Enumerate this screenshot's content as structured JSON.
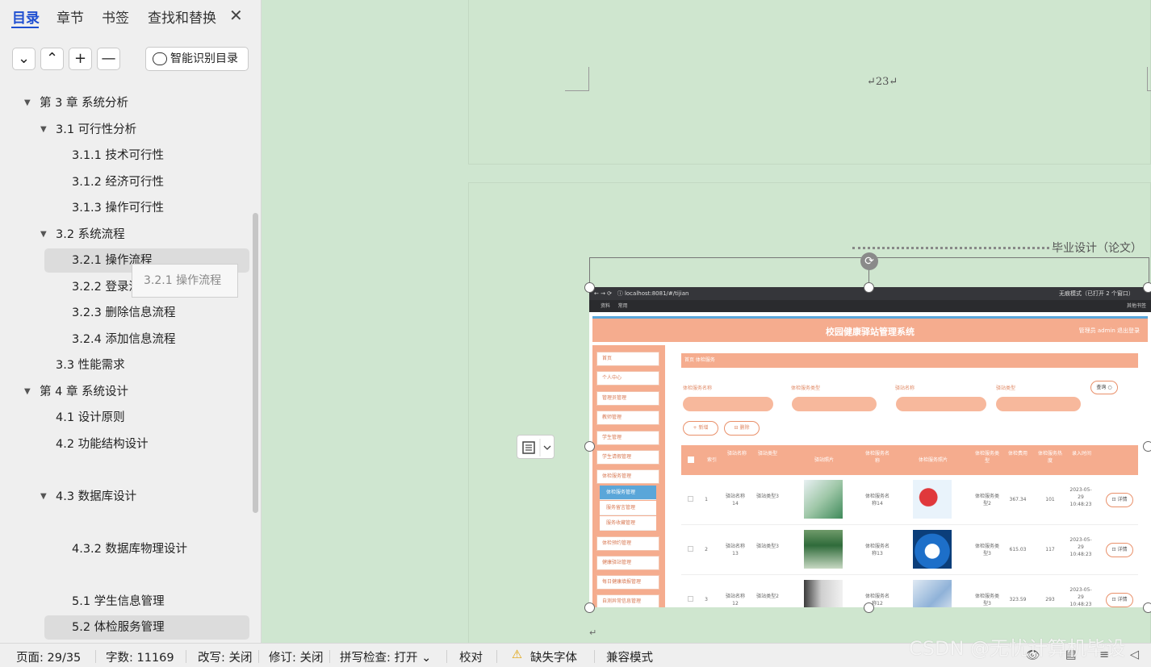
{
  "sidebar": {
    "tabs": [
      "目录",
      "章节",
      "书签",
      "查找和替换"
    ],
    "close": "✕",
    "toolbar": {
      "collapse": "⌄",
      "expand": "⌃",
      "add": "+",
      "remove": "—",
      "smart": "智能识别目录"
    },
    "items": [
      {
        "label": "第 3 章  系统分析",
        "expanded": true
      },
      {
        "label": "3.1  可行性分析",
        "expanded": true
      },
      {
        "label": "3.1.1  技术可行性"
      },
      {
        "label": "3.1.2  经济可行性"
      },
      {
        "label": "3.1.3  操作可行性"
      },
      {
        "label": "3.2  系统流程",
        "expanded": true
      },
      {
        "label": "3.2.1  操作流程",
        "hover": true
      },
      {
        "label": "3.2.2  登录流程"
      },
      {
        "label": "3.2.3  删除信息流程"
      },
      {
        "label": "3.2.4  添加信息流程"
      },
      {
        "label": "3.3  性能需求"
      },
      {
        "label": "第 4 章  系统设计",
        "expanded": true
      },
      {
        "label": "4.1  设计原则"
      },
      {
        "label": "4.2  功能结构设计"
      },
      {
        "label": "4.3  数据库设计",
        "expanded": true
      },
      {
        "label": "4.3.2  数据库物理设计"
      },
      {
        "label": "5.1 学生信息管理"
      },
      {
        "label": "5.2  体检服务管理",
        "selected": true
      }
    ],
    "tooltip": "3.2.1 操作流程"
  },
  "document": {
    "page_number": "↵23↵",
    "header_text": "毕业设计（论文）",
    "paragraph_mark": "↵"
  },
  "screenshot": {
    "url": "localhost:8081/#/tijian",
    "incognito": "无痕模式（已打开 2 个窗口）",
    "bookmarks": [
      "资料",
      "常用"
    ],
    "other_bookmarks": "其他书签",
    "app_title": "校园健康驿站管理系统",
    "app_user": "管理员 admin    退出登录",
    "menu": [
      "首页",
      "个人中心",
      "管理员管理",
      "教师管理",
      "学生管理",
      "学生请假管理",
      "体检服务管理"
    ],
    "submenu": [
      "体检服务管理",
      "服务留言管理",
      "服务收藏管理"
    ],
    "menu_after": [
      "体检预约管理",
      "健康驿站管理",
      "每日健康填报管理",
      "自测异常信息管理"
    ],
    "breadcrumb": "首页    体检服务",
    "filters": [
      "体检服务名称",
      "体检服务类型",
      "驿站名称",
      "驿站类型"
    ],
    "filter_placeholders": [
      "体检服务名称",
      "请选择体检服务类型",
      "驿站名称",
      "请选择驿站类型"
    ],
    "query": "查询 ○",
    "add": "+ 新增",
    "delete": "⊟ 删除",
    "columns": [
      "",
      "索引",
      "驿站名称",
      "驿站类型",
      "驿站照片",
      "体检服务名称",
      "体检服务照片",
      "体检服务类型",
      "体检费用",
      "体检服务热度",
      "录入时间"
    ],
    "rows": [
      {
        "idx": "1",
        "name": "驿站名称14",
        "type": "驿站类型3",
        "svc": "体检服务名称14",
        "svctype": "体检服务类型2",
        "fee": "367.34",
        "hot": "101",
        "time": "2023-05-29 10:48:23"
      },
      {
        "idx": "2",
        "name": "驿站名称13",
        "type": "驿站类型3",
        "svc": "体检服务名称13",
        "svctype": "体检服务类型3",
        "fee": "615.03",
        "hot": "117",
        "time": "2023-05-29 10:48:23"
      },
      {
        "idx": "3",
        "name": "驿站名称12",
        "type": "驿站类型2",
        "svc": "体检服务名称12",
        "svctype": "体检服务类型3",
        "fee": "323.59",
        "hot": "293",
        "time": "2023-05-29 10:48:23"
      }
    ],
    "detail": "⊡ 详情"
  },
  "status": {
    "page": "页面: 29/35",
    "words": "字数: 11169",
    "overwrite": "改写: 关闭",
    "revise": "修订: 关闭",
    "spell": "拼写检查: 打开 ⌄",
    "proof": "校对",
    "missing_font": "缺失字体",
    "compat": "兼容模式"
  },
  "watermark": "CSDN @无忧计算机毕设",
  "colors": {
    "accent": "#1f4fd1",
    "app_salmon": "#f5ac8e",
    "app_blue": "#5aa6d9",
    "page_bg": "#cfe6d0"
  }
}
